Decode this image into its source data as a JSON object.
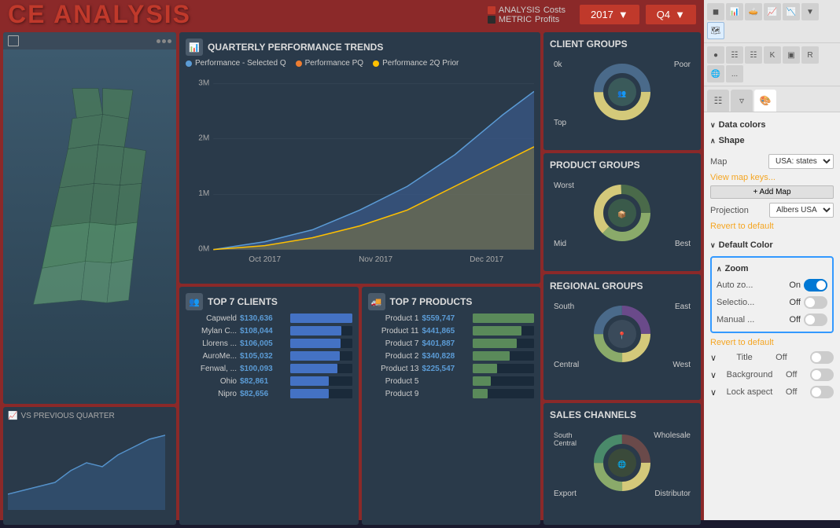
{
  "header": {
    "title": "CE ANALYSIS",
    "year_label": "2017",
    "quarter_label": "Q4",
    "analysis_label": "ANALYSIS",
    "metric_label": "METRIC",
    "costs_label": "Costs",
    "profits_label": "Profits"
  },
  "quarterly": {
    "title": "QUARTERLY PERFORMANCE TRENDS",
    "legend": [
      {
        "label": "Performance - Selected Q",
        "color": "blue"
      },
      {
        "label": "Performance PQ",
        "color": "orange"
      },
      {
        "label": "Performance 2Q Prior",
        "color": "gold"
      }
    ],
    "y_labels": [
      "3M",
      "2M",
      "1M",
      "0M"
    ],
    "x_labels": [
      "Oct 2017",
      "Nov 2017",
      "Dec 2017"
    ]
  },
  "top_clients": {
    "title": "TOP 7 CLIENTS",
    "rows": [
      {
        "name": "Capweld",
        "value": "$130,636",
        "pct": 100
      },
      {
        "name": "Mylan C...",
        "value": "$108,044",
        "pct": 83
      },
      {
        "name": "Llorens ...",
        "value": "$106,005",
        "pct": 81
      },
      {
        "name": "AuroMe...",
        "value": "$105,032",
        "pct": 80
      },
      {
        "name": "Fenwal, ...",
        "value": "$100,093",
        "pct": 77
      },
      {
        "name": "Ohio",
        "value": "$82,861",
        "pct": 63
      },
      {
        "name": "Nipro",
        "value": "$82,656",
        "pct": 63
      }
    ]
  },
  "top_products": {
    "title": "TOP 7 PRODUCTS",
    "rows": [
      {
        "name": "Product 1",
        "value": "$559,747",
        "pct": 100
      },
      {
        "name": "Product 11",
        "value": "$441,865",
        "pct": 79
      },
      {
        "name": "Product 7",
        "value": "$401,887",
        "pct": 72
      },
      {
        "name": "Product 2",
        "value": "$340,828",
        "pct": 61
      },
      {
        "name": "Product 13",
        "value": "$225,547",
        "pct": 40
      },
      {
        "name": "Product 5",
        "value": "",
        "pct": 30
      },
      {
        "name": "Product 9",
        "value": "",
        "pct": 25
      }
    ]
  },
  "client_groups": {
    "title": "CLIENT GROUPS",
    "labels": [
      "0k",
      "Top",
      "Poor"
    ]
  },
  "product_groups": {
    "title": "PRODUCT GROUPS",
    "labels": [
      "Worst",
      "Mid",
      "Best"
    ]
  },
  "regional_groups": {
    "title": "REGIONAL GROUPS",
    "labels": [
      "South",
      "Central",
      "East",
      "West"
    ]
  },
  "sales_channels": {
    "title": "SALES CHANNELS",
    "labels": [
      "South Central",
      "Export",
      "Wholesale",
      "Distributor"
    ]
  },
  "map": {
    "label": "VS PREVIOUS QUARTER"
  },
  "right_panel": {
    "data_colors_label": "Data colors",
    "shape_label": "Shape",
    "map_label": "Map",
    "map_value": "USA: states",
    "view_map_keys": "View map keys...",
    "add_map_label": "+ Add Map",
    "projection_label": "Projection",
    "projection_value": "Albers USA",
    "revert_label": "Revert to default",
    "default_color_label": "Default Color",
    "zoom_label": "Zoom",
    "auto_zoom_label": "Auto zo...",
    "auto_zoom_status": "On",
    "selection_label": "Selectio...",
    "selection_status": "Off",
    "manual_label": "Manual ...",
    "manual_status": "Off",
    "revert2_label": "Revert to default",
    "title_label": "Title",
    "title_status": "Off",
    "background_label": "Background",
    "background_status": "Off",
    "lock_aspect_label": "Lock aspect",
    "lock_aspect_status": "Off"
  }
}
